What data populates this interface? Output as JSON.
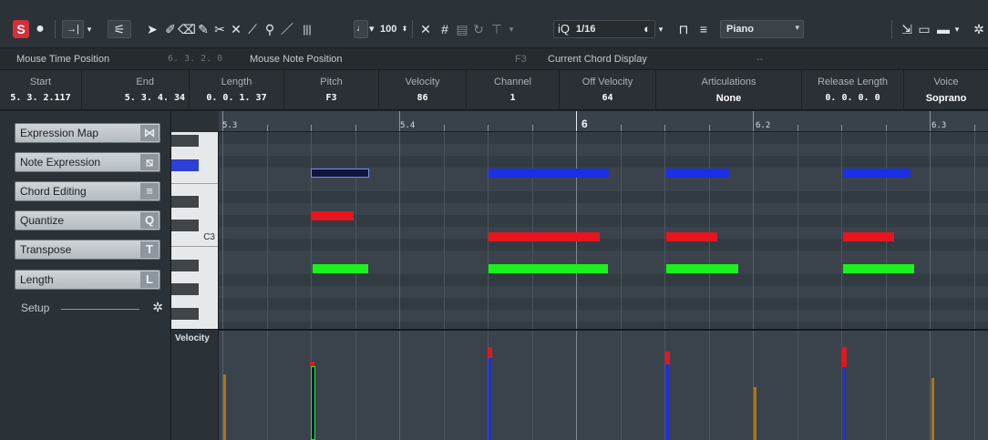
{
  "toolbar": {
    "zoom_value": "100",
    "quantize_label": "iQ",
    "quantize_value": "1/16",
    "instrument": "Piano"
  },
  "status_line": {
    "mouse_time_label": "Mouse Time Position",
    "mouse_time_value": "6. 3. 2.   0",
    "mouse_note_label": "Mouse Note Position",
    "mouse_note_value": "F3",
    "chord_label": "Current Chord Display",
    "chord_value": "--"
  },
  "info_line": [
    {
      "label": "Start",
      "value": "5. 3. 2.117"
    },
    {
      "label": "End",
      "value": "5. 3. 4. 34"
    },
    {
      "label": "Length",
      "value": "0. 0. 1. 37"
    },
    {
      "label": "Pitch",
      "value": "F3"
    },
    {
      "label": "Velocity",
      "value": "86"
    },
    {
      "label": "Channel",
      "value": "1"
    },
    {
      "label": "Off Velocity",
      "value": "64"
    },
    {
      "label": "Articulations",
      "value": "None"
    },
    {
      "label": "Release Length",
      "value": "0. 0. 0.   0"
    },
    {
      "label": "Voice",
      "value": "Soprano"
    }
  ],
  "left_panel": {
    "items": [
      {
        "label": "Expression Map",
        "icon": "expression-map-icon",
        "glyph": "⋈"
      },
      {
        "label": "Note Expression",
        "icon": "note-expression-icon",
        "glyph": "⧅"
      },
      {
        "label": "Chord Editing",
        "icon": "chord-editing-icon",
        "glyph": "≡"
      },
      {
        "label": "Quantize",
        "icon": "quantize-icon",
        "glyph": "Q"
      },
      {
        "label": "Transpose",
        "icon": "transpose-icon",
        "glyph": "T"
      },
      {
        "label": "Length",
        "icon": "length-icon",
        "glyph": "L"
      }
    ],
    "setup_label": "Setup"
  },
  "ruler": {
    "labels": [
      "5.3",
      "5.4",
      "6",
      "6.2",
      "6.3"
    ]
  },
  "keyboard": {
    "c3_label": "C3"
  },
  "velocity_lane": {
    "label": "Velocity"
  },
  "colors": {
    "accent_red": "#d2303a",
    "note_blue": "#1b2fe6",
    "note_red": "#e8141e",
    "note_green": "#19f21c",
    "note_selected": "#10163a",
    "velocity_orange": "#b07514"
  }
}
